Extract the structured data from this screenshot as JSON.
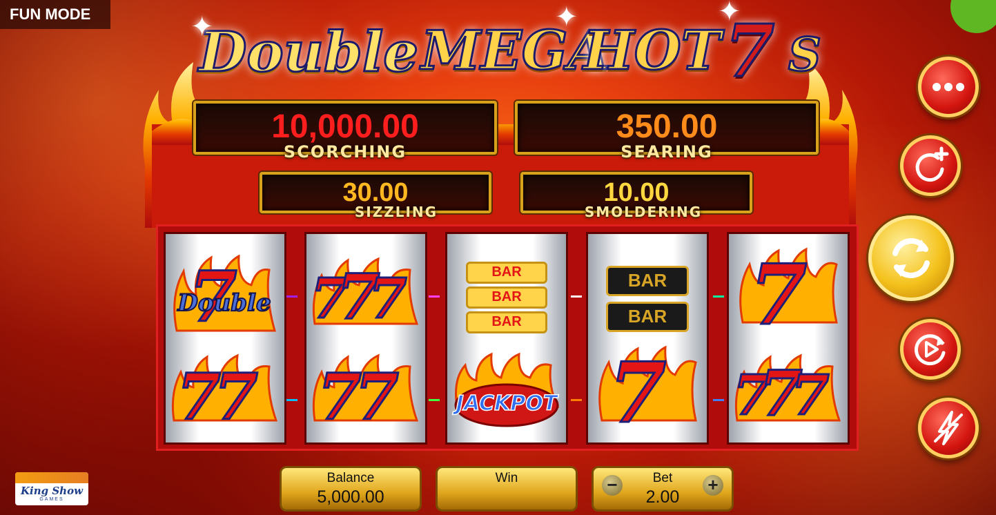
{
  "mode_label": "FUN MODE",
  "title": {
    "word1": "Double",
    "word2": "MEGA",
    "word3": "HOT",
    "seven": "7",
    "s": "S"
  },
  "jackpots": [
    {
      "label": "SCORCHING",
      "value": "10,000.00",
      "color": "#ff1e1e"
    },
    {
      "label": "SEARING",
      "value": "350.00",
      "color": "#ff8c1a"
    },
    {
      "label": "SIZZLING",
      "value": "30.00",
      "color": "#ffb820"
    },
    {
      "label": "SMOLDERING",
      "value": "10.00",
      "color": "#ffd840"
    }
  ],
  "reels": {
    "symbol_labels": {
      "double": "Double",
      "bar": "BAR",
      "jackpot": "JACKPOT"
    },
    "columns": [
      [
        "double-7",
        "double-7s"
      ],
      [
        "triple-7s",
        "double-7s"
      ],
      [
        "triple-bar",
        "jackpot"
      ],
      [
        "double-bar",
        "single-7"
      ],
      [
        "single-7",
        "triple-7s"
      ]
    ]
  },
  "balance": {
    "label": "Balance",
    "value": "5,000.00"
  },
  "win": {
    "label": "Win",
    "value": ""
  },
  "bet": {
    "label": "Bet",
    "value": "2.00",
    "minus": "−",
    "plus": "+"
  },
  "logo": {
    "name": "King Show",
    "sub": "GAMES"
  },
  "side_buttons": [
    {
      "icon": "more-icon"
    },
    {
      "icon": "bonus-refresh-icon"
    },
    {
      "icon": "spin-icon"
    },
    {
      "icon": "autoplay-icon"
    },
    {
      "icon": "turbo-icon"
    }
  ],
  "colors": {
    "accent_gold": "#d9a526",
    "reel_frame": "#b00c0c",
    "seven_red": "#e31515",
    "seven_outline": "#1d1e7a"
  }
}
